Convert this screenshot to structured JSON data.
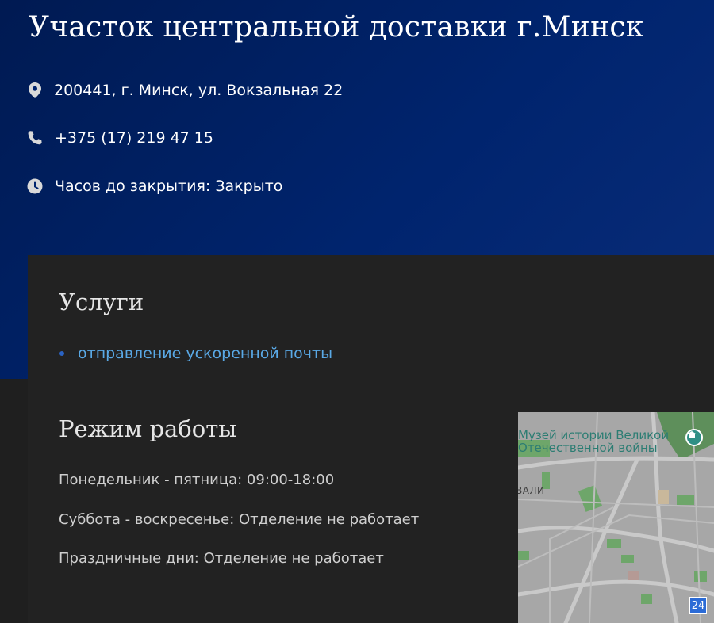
{
  "header": {
    "title": "Участок центральной доставки г.Минск"
  },
  "contacts": {
    "address": "200441, г. Минск, ул. Вокзальная 22",
    "phone": "+375 (17) 219 47 15",
    "hours_status": "Часов до закрытия: Закрыто",
    "icons": [
      "location-pin-icon",
      "phone-icon",
      "clock-icon"
    ]
  },
  "services": {
    "title": "Услуги",
    "items": [
      {
        "label": "отправление ускоренной почты"
      }
    ]
  },
  "schedule": {
    "title": "Режим работы",
    "lines": [
      "Понедельник - пятница: 09:00-18:00",
      "Суббота - воскресенье: Отделение не работает",
      "Праздничные дни: Отделение не работает"
    ]
  },
  "map": {
    "poi_line1": "Музей истории Великой",
    "poi_line2": "Отечественной войны",
    "street_fragment": "ВАЛИ",
    "badge": "24"
  },
  "colors": {
    "hero_bg": "#00246e",
    "card_bg": "#222222",
    "link": "#5aa9e6",
    "bullet": "#2a63c4"
  }
}
